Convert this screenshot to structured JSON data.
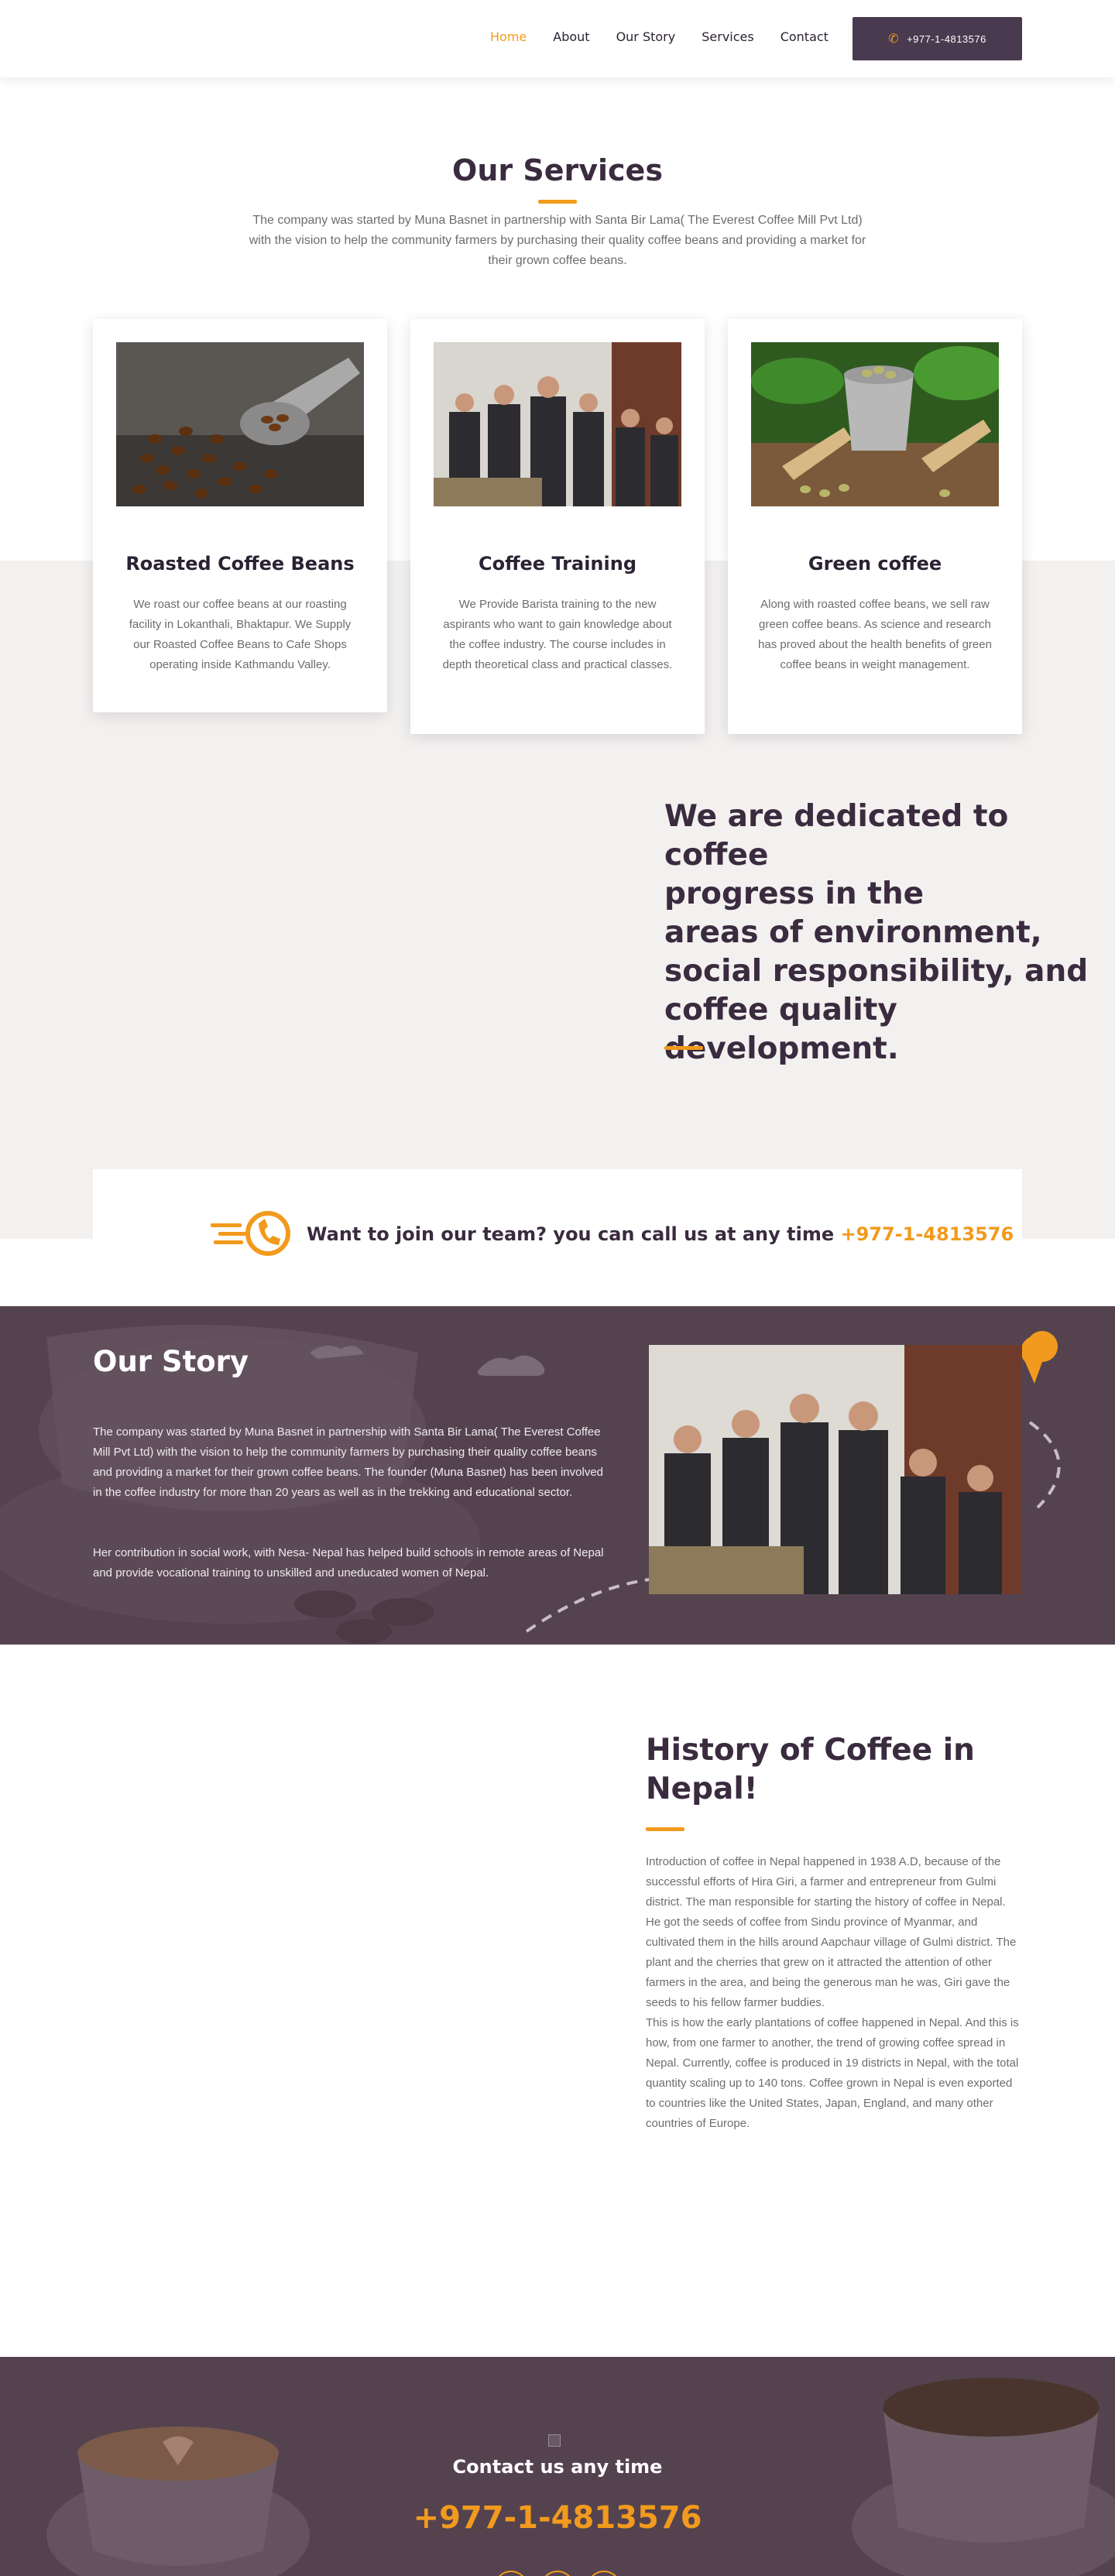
{
  "nav": {
    "items": [
      {
        "label": "Home",
        "active": true
      },
      {
        "label": "About"
      },
      {
        "label": "Our Story"
      },
      {
        "label": "Services"
      },
      {
        "label": "Contact"
      }
    ],
    "call_button": "+977-1-4813576"
  },
  "services": {
    "title": "Our Services",
    "intro": "The company was started by Muna Basnet in partnership with Santa Bir Lama( The Everest Coffee Mill Pvt Ltd)  with the vision to help the community farmers by purchasing their quality coffee beans and providing a market for their grown coffee beans.",
    "cards": [
      {
        "title": "Roasted Coffee Beans",
        "text": "We roast our coffee beans at our roasting facility in Lokanthali, Bhaktapur. We Supply our Roasted Coffee Beans to Cafe Shops operating inside Kathmandu Valley."
      },
      {
        "title": "Coffee Training",
        "text": "We Provide Barista training to the new aspirants who want to gain knowledge about the coffee industry. The course includes in depth theoretical class and practical classes."
      },
      {
        "title": "Green coffee",
        "text": "Along with roasted coffee beans, we sell raw green coffee beans. As science and research has proved about the health benefits of green coffee beans in weight management."
      }
    ]
  },
  "dedicated": {
    "line1": "We are dedicated to coffee",
    "line2": "progress in the",
    "line3": "areas of environment,",
    "line4": "social responsibility, and",
    "line5": "coffee quality",
    "line6": "development."
  },
  "join": {
    "text": "Want to join our team? you can call us at any time ",
    "phone": "+977-1-4813576"
  },
  "story": {
    "title": "Our Story",
    "p1": "The company was started by Muna Basnet in partnership with Santa Bir Lama( The Everest Coffee Mill Pvt Ltd)  with the vision to help the community farmers by purchasing their quality coffee beans and providing a market for their grown coffee beans. The founder (Muna Basnet) has been involved in the coffee industry for more than 20 years as well as in the trekking and educational sector.",
    "p2": "Her contribution in social work, with Nesa- Nepal has helped build schools in remote areas of Nepal and provide vocational training to unskilled and uneducated women of Nepal."
  },
  "history": {
    "title": "History of Coffee in Nepal!",
    "text": "Introduction of coffee in Nepal happened in 1938 A.D, because of the successful efforts of Hira Giri, a farmer and entrepreneur from Gulmi district. The man responsible for starting the history of coffee in Nepal. He got the seeds of coffee from Sindu province of Myanmar, and cultivated them in the hills around Aapchaur village of Gulmi district. The plant and the cherries that grew on it attracted the attention of other farmers in the area, and being the generous man he was, Giri gave the seeds to his fellow farmer buddies.",
    "text2": "This is how the early plantations of coffee happened in Nepal. And this is how, from one farmer to another, the trend of growing coffee spread in Nepal. Currently, coffee is produced in 19 districts in Nepal, with the total quantity scaling up to 140 tons. Coffee grown in Nepal is even exported to countries like the United States, Japan, England, and many other countries of Europe."
  },
  "footer": {
    "contact": "Contact us any time",
    "phone": "+977-1-4813576"
  },
  "colors": {
    "accent": "#f29a1d",
    "plum": "#54434f",
    "dark": "#3a2b3f"
  }
}
